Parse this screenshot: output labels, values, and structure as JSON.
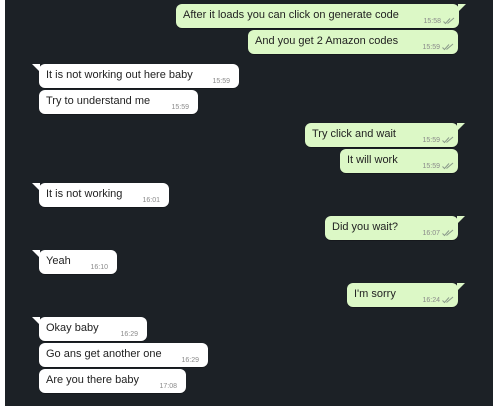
{
  "colors": {
    "background": "#1c2126",
    "outgoing_bubble": "#dcf8c6",
    "incoming_bubble": "#ffffff",
    "tick_color": "#8a9a8a"
  },
  "messages": [
    {
      "direction": "out",
      "text": "After it loads you can click on generate code",
      "time": "15:58"
    },
    {
      "direction": "out",
      "text": "And you get 2 Amazon codes",
      "time": "15:59"
    },
    {
      "direction": "in",
      "text": "It is not working out here baby",
      "time": "15:59"
    },
    {
      "direction": "in",
      "text": "Try to understand me",
      "time": "15:59"
    },
    {
      "direction": "out",
      "text": "Try click and wait",
      "time": "15:59"
    },
    {
      "direction": "out",
      "text": "It will work",
      "time": "15:59"
    },
    {
      "direction": "in",
      "text": "It is not working",
      "time": "16:01"
    },
    {
      "direction": "out",
      "text": "Did you wait?",
      "time": "16:07"
    },
    {
      "direction": "in",
      "text": "Yeah",
      "time": "16:10"
    },
    {
      "direction": "out",
      "text": "I'm sorry",
      "time": "16:24"
    },
    {
      "direction": "in",
      "text": "Okay baby",
      "time": "16:29"
    },
    {
      "direction": "in",
      "text": "Go ans get another one",
      "time": "16:29"
    },
    {
      "direction": "in",
      "text": "Are you there baby",
      "time": "17:08"
    }
  ]
}
